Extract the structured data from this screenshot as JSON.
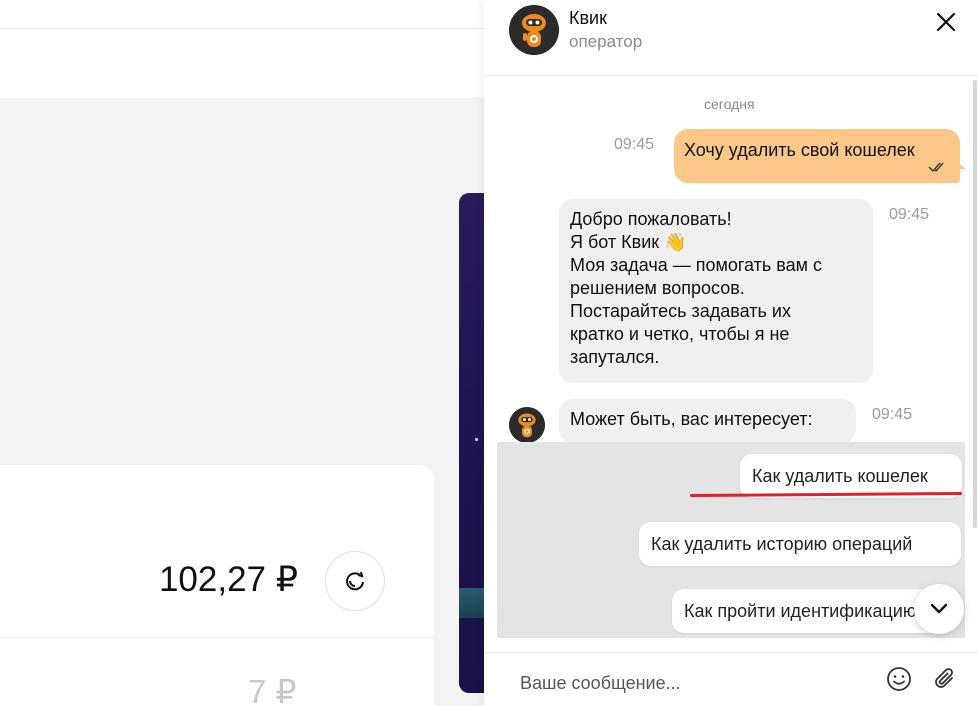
{
  "background": {
    "balance": "102,27 ₽",
    "second_amount": "7 ₽"
  },
  "chat": {
    "header": {
      "name": "Квик",
      "role": "оператор"
    },
    "date_separator": "сегодня",
    "messages": [
      {
        "direction": "outgoing",
        "time": "09:45",
        "text": "Хочу удалить свой кошелек",
        "status": "read"
      },
      {
        "direction": "incoming",
        "time": "09:45",
        "lines": [
          "Добро пожаловать!",
          "Я бот Квик 👋",
          "Моя задача — помогать вам с",
          "решением вопросов.",
          "Постарайтесь задавать их",
          "кратко и четко, чтобы я не",
          "запутался."
        ]
      },
      {
        "direction": "incoming",
        "time": "09:45",
        "text": "Может быть, вас интересует:"
      }
    ],
    "suggestions": [
      "Как удалить кошелек",
      "Как удалить историю операций",
      "Как пройти идентификацию"
    ],
    "composer": {
      "placeholder": "Ваше сообщение..."
    },
    "colors": {
      "outgoing_bubble": "#fcc88a",
      "incoming_bubble": "#f0f0f0",
      "accent_underline": "#e0202a",
      "bot_avatar": "#f08a1c"
    }
  }
}
